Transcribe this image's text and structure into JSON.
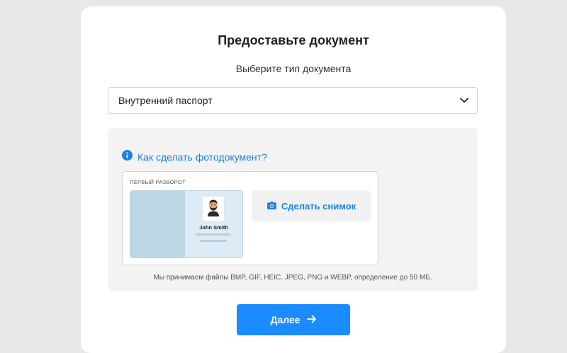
{
  "page": {
    "title": "Предоставьте документ",
    "subtitle": "Выберите тип документа"
  },
  "document_select": {
    "selected": "Внутренний паспорт",
    "icon": "chevron-down-icon"
  },
  "help": {
    "link_label": "Как сделать фотодокумент?",
    "icon": "info-icon"
  },
  "spread": {
    "label": "ПЕРВЫЙ РАЗВОРОТ",
    "sample_name": "John Smith"
  },
  "capture": {
    "button_label": "Сделать снимок",
    "icon": "camera-icon"
  },
  "formats_note": "Мы принимаем файлы BMP, GIF, HEIC, JPEG, PNG и WEBP, определение до 50 МБ.",
  "next": {
    "label": "Далее",
    "icon": "arrow-right-icon"
  },
  "colors": {
    "accent": "#1a8cff",
    "link": "#1a82e2",
    "panel_bg": "#f3f3f3",
    "page_bg": "#e8e8e8"
  }
}
